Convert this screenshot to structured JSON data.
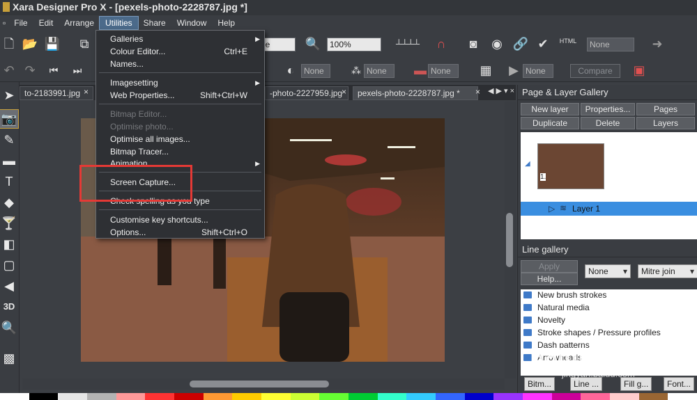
{
  "window": {
    "title": "Xara Designer Pro X - [pexels-photo-2228787.jpg *]"
  },
  "menubar": [
    "File",
    "Edit",
    "Arrange",
    "Utilities",
    "Share",
    "Window",
    "Help"
  ],
  "toolbar": {
    "font_field": "ne",
    "zoom": "100%",
    "html_label": "HTML",
    "none_field": "None"
  },
  "toolbar2": {
    "none1": "None",
    "none2": "None",
    "none3": "None",
    "none4": "None",
    "compare": "Compare"
  },
  "doc_tabs": [
    "to-2183991.jpg",
    "-photo-2227959.jpg",
    "pexels-photo-2228787.jpg *"
  ],
  "utilities_menu": {
    "galleries": "Galleries",
    "colour_editor": "Colour Editor...",
    "colour_editor_sc": "Ctrl+E",
    "names": "Names...",
    "imagesetting": "Imagesetting",
    "web_properties": "Web Properties...",
    "web_properties_sc": "Shift+Ctrl+W",
    "bitmap_editor": "Bitmap Editor...",
    "optimise_photo": "Optimise photo...",
    "optimise_all": "Optimise all images...",
    "bitmap_tracer": "Bitmap Tracer...",
    "animation": "Animation",
    "screen_capture": "Screen Capture...",
    "check_spelling": "Check spelling as you type",
    "customise_keys": "Customise key shortcuts...",
    "options": "Options...",
    "options_sc": "Shift+Ctrl+O"
  },
  "page_layer_gallery": {
    "title": "Page & Layer Gallery",
    "new_layer": "New layer",
    "properties": "Properties...",
    "pages": "Pages",
    "duplicate": "Duplicate",
    "delete": "Delete",
    "layers": "Layers",
    "page_number": "1.",
    "layer_name": "Layer 1"
  },
  "line_gallery": {
    "title": "Line gallery",
    "apply": "Apply",
    "help": "Help...",
    "none_select": "None",
    "join_select": "Mitre join",
    "items": [
      "New brush strokes",
      "Natural media",
      "Novelty",
      "Stroke shapes / Pressure profiles",
      "Dash patterns",
      "Arrowheads"
    ]
  },
  "bottom_tabs": [
    "Bitm...",
    "Line ...",
    "Fill g...",
    "Font..."
  ],
  "watermark": {
    "brand": "Baidu 经验",
    "url": "jingyan.baidu.com"
  }
}
